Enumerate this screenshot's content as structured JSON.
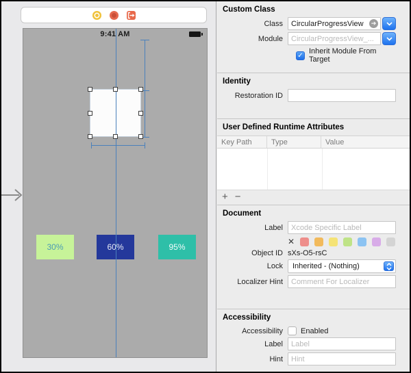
{
  "canvas": {
    "status_time": "9:41 AM",
    "constraint_color": "#4a80bb",
    "progress_boxes": [
      {
        "label": "30%",
        "bg": "#c7f399",
        "fg": "#4b9cb3"
      },
      {
        "label": "60%",
        "bg": "#24389b",
        "fg": "#e9edf7"
      },
      {
        "label": "95%",
        "bg": "#2ebfa8",
        "fg": "#f2fbfa"
      }
    ]
  },
  "inspector": {
    "custom_class": {
      "title": "Custom Class",
      "class_label": "Class",
      "class_value": "CircularProgressView",
      "module_label": "Module",
      "module_placeholder": "CircularProgressView_...",
      "inherit_checkbox_label": "Inherit Module From Target",
      "checkmark": "✓"
    },
    "identity": {
      "title": "Identity",
      "restoration_label": "Restoration ID"
    },
    "runtime_attributes": {
      "title": "User Defined Runtime Attributes",
      "columns": [
        "Key Path",
        "Type",
        "Value"
      ],
      "add_label": "+",
      "remove_label": "−"
    },
    "document": {
      "title": "Document",
      "label_label": "Label",
      "label_placeholder": "Xcode Specific Label",
      "clear_color_label": "✕",
      "swatch_colors": [
        "#ee8e8b",
        "#f2ba5c",
        "#f5e376",
        "#bfe387",
        "#8cc3f2",
        "#d8ace8",
        "#d4d4d4"
      ],
      "object_id_label": "Object ID",
      "object_id_value": "sXs-O5-rsC",
      "lock_label": "Lock",
      "lock_value": "Inherited - (Nothing)",
      "localizer_label": "Localizer Hint",
      "localizer_placeholder": "Comment For Localizer"
    },
    "accessibility": {
      "title": "Accessibility",
      "accessibility_label": "Accessibility",
      "enabled_label": "Enabled",
      "label_label": "Label",
      "label_placeholder": "Label",
      "hint_label": "Hint",
      "hint_placeholder": "Hint"
    }
  }
}
